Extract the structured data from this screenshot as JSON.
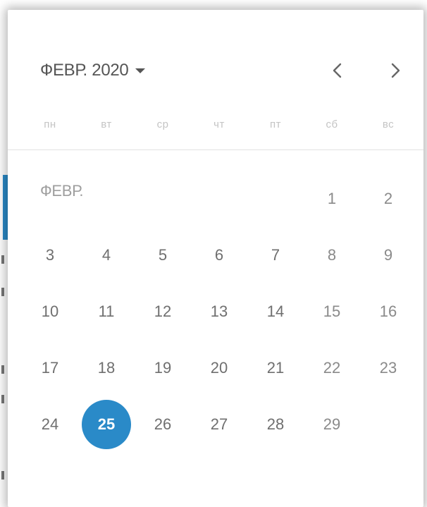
{
  "header": {
    "month_year": "ФЕВР. 2020"
  },
  "weekdays": [
    "пн",
    "вт",
    "ср",
    "чт",
    "пт",
    "сб",
    "вс"
  ],
  "grid": {
    "month_label": "ФЕВР.",
    "weeks": [
      [
        "",
        "",
        "",
        "",
        "",
        "1",
        "2"
      ],
      [
        "3",
        "4",
        "5",
        "6",
        "7",
        "8",
        "9"
      ],
      [
        "10",
        "11",
        "12",
        "13",
        "14",
        "15",
        "16"
      ],
      [
        "17",
        "18",
        "19",
        "20",
        "21",
        "22",
        "23"
      ],
      [
        "24",
        "25",
        "26",
        "27",
        "28",
        "29",
        ""
      ]
    ],
    "selected_day": "25"
  },
  "icons": {
    "month_dropdown": "caret-down-icon",
    "prev": "chevron-left-icon",
    "next": "chevron-right-icon"
  },
  "colors": {
    "accent": "#2a8ac8",
    "text": "#6f6f6f",
    "weekday_text": "#c4c4c4",
    "divider": "#e2e2e2"
  }
}
